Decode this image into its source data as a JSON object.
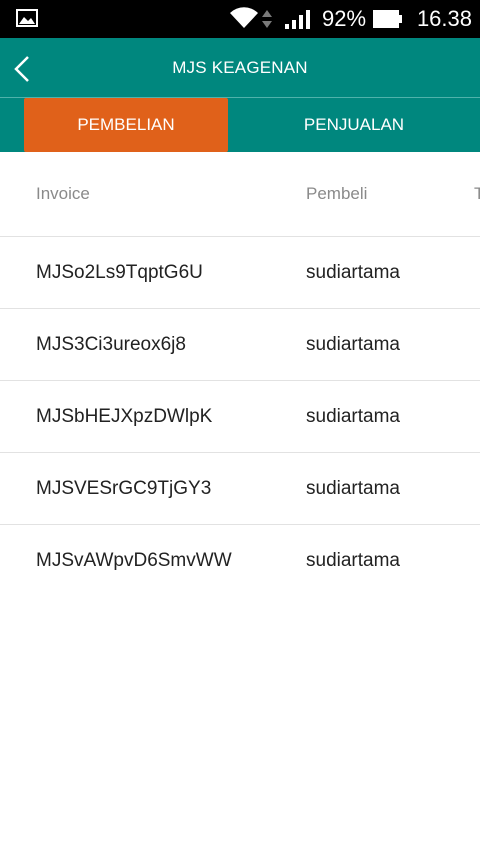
{
  "status_bar": {
    "battery_percent": "92%",
    "time": "16.38",
    "icons": [
      "gallery-icon",
      "wifi-icon",
      "data-arrows-icon",
      "signal-icon",
      "battery-icon"
    ]
  },
  "header": {
    "title": "MJS KEAGENAN",
    "back_icon": "chevron-left-icon"
  },
  "tabs": [
    {
      "label": "PEMBELIAN",
      "active": true
    },
    {
      "label": "PENJUALAN",
      "active": false
    }
  ],
  "table": {
    "columns": [
      "Invoice",
      "Pembeli",
      "T"
    ],
    "rows": [
      {
        "invoice": "MJSo2Ls9TqptG6U",
        "buyer": "sudiartama"
      },
      {
        "invoice": "MJS3Ci3ureox6j8",
        "buyer": "sudiartama"
      },
      {
        "invoice": "MJSbHEJXpzDWlpK",
        "buyer": "sudiartama"
      },
      {
        "invoice": "MJSVESrGC9TjGY3",
        "buyer": "sudiartama"
      },
      {
        "invoice": "MJSvAWpvD6SmvWW",
        "buyer": "sudiartama"
      }
    ]
  },
  "colors": {
    "status_bar": "#000000",
    "primary": "#00877e",
    "tab_active": "#e0611a",
    "divider": "#e2e2e2",
    "header_text_gray": "#8a8a8a"
  }
}
